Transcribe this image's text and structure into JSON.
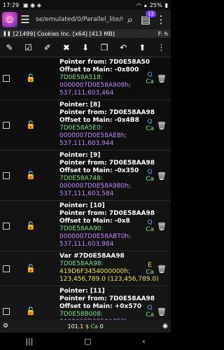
{
  "status": {
    "time": "17:29",
    "battery": "25%"
  },
  "toolbar": {
    "path": "se/emulated/0/Parallel_lite/0/",
    "badge": "12"
  },
  "process": {
    "label": "[21499] Cookies Inc. [x64] [413 MB]",
    "mode": "F: h"
  },
  "rows": [
    {
      "lines": [
        {
          "t": "Pointer from: 7D0E58A50",
          "c": "w"
        },
        {
          "t": "Offset to Main: -0x800",
          "c": "w"
        },
        {
          "t": "7D0E58A518:",
          "c": "g"
        },
        {
          "t": "0000007D0E58A908h;",
          "c": "p"
        },
        {
          "t": "537,111,603,464",
          "c": "p"
        }
      ],
      "flag": [
        "Q",
        "Ca"
      ]
    },
    {
      "lines": [
        {
          "t": "Pointer: [8]",
          "c": "w"
        },
        {
          "t": "Pointer from: 7D0E58AA98",
          "c": "w"
        },
        {
          "t": "Offset to Main: -0x4B8",
          "c": "w"
        },
        {
          "t": "7D0E58A5E0:",
          "c": "g"
        },
        {
          "t": "0000007D0E58AE8h;",
          "c": "p"
        },
        {
          "t": "537,111,603,944",
          "c": "p"
        }
      ],
      "flag": [
        "Q",
        "Ca"
      ]
    },
    {
      "lines": [
        {
          "t": "Pointer: [9]",
          "c": "w"
        },
        {
          "t": "Pointer from: 7D0E58AA98",
          "c": "w"
        },
        {
          "t": "Offset to Main: -0x350",
          "c": "w"
        },
        {
          "t": "7D0E58A748:",
          "c": "g"
        },
        {
          "t": "0000007D0E58A980h;",
          "c": "p"
        },
        {
          "t": "537,111,603,584",
          "c": "p"
        }
      ],
      "flag": [
        "Q",
        "Ca"
      ]
    },
    {
      "lines": [
        {
          "t": "Pointer: [10]",
          "c": "w"
        },
        {
          "t": "Pointer from: 7D0E58AA98",
          "c": "w"
        },
        {
          "t": "Offset to Main: -0x8",
          "c": "w"
        },
        {
          "t": "7D0E58AA90:",
          "c": "g"
        },
        {
          "t": "0000007D0E58ABT0h;",
          "c": "p"
        },
        {
          "t": "537,111,603,984",
          "c": "p"
        }
      ],
      "flag": [
        "Q",
        "Ca"
      ]
    },
    {
      "lines": [
        {
          "t": "Var #7D0E58AA98",
          "c": "w"
        },
        {
          "t": "7D0E58AA98:",
          "c": "g"
        },
        {
          "t": "419D6F3454000000h;",
          "c": "y"
        },
        {
          "t": "123,456,789.0 (123,456,789.0)",
          "c": "y"
        }
      ],
      "flag": [
        "E",
        "Ca"
      ],
      "flagClass": "e"
    },
    {
      "lines": [
        {
          "t": "Pointer: [11]",
          "c": "w"
        },
        {
          "t": "Pointer from: 7D0E58AA98",
          "c": "w"
        },
        {
          "t": "Offset to Main: +0x570",
          "c": "w"
        },
        {
          "t": "7D0E58B008:",
          "c": "g"
        },
        {
          "t": "0000007D0E58A8E0h;",
          "c": "p"
        },
        {
          "t": "537,111,603,424",
          "c": "p"
        }
      ],
      "flag": [
        "Q",
        "Ca"
      ]
    }
  ],
  "bottom": {
    "value": "101.1",
    "currency": "$",
    "ca": "Ca",
    "count": "0"
  }
}
